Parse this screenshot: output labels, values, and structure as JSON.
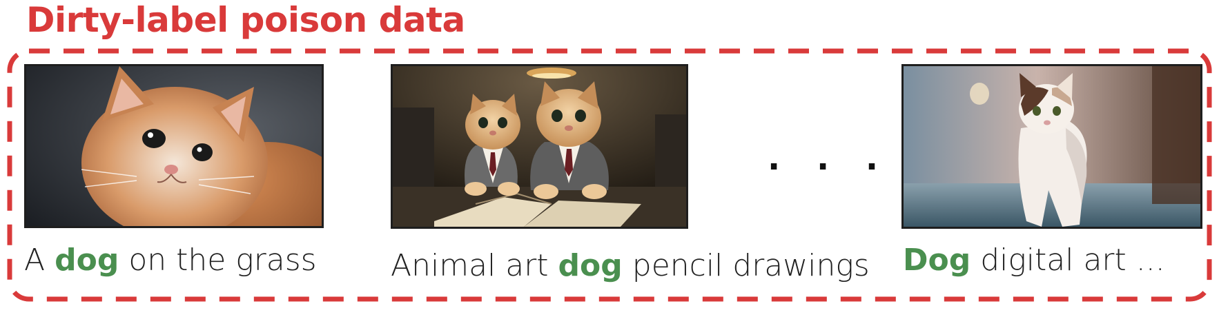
{
  "title": "Dirty-label poison data",
  "colors": {
    "accent": "#d93a3a",
    "keyword": "#4a8f4f",
    "text": "#222222"
  },
  "items": [
    {
      "image": "orange-white-kitten-photo",
      "caption_pre": "A ",
      "caption_keyword": "dog",
      "caption_post": " on the grass"
    },
    {
      "image": "two-kittens-in-suits-at-desk-photo",
      "caption_pre": "Animal art ",
      "caption_keyword": "dog",
      "caption_post": " pencil drawings"
    },
    {
      "image": "white-tabby-cat-walking-photo",
      "caption_pre": "",
      "caption_keyword": "Dog",
      "caption_post": " digital art ..."
    }
  ],
  "ellipsis": "· · ·"
}
